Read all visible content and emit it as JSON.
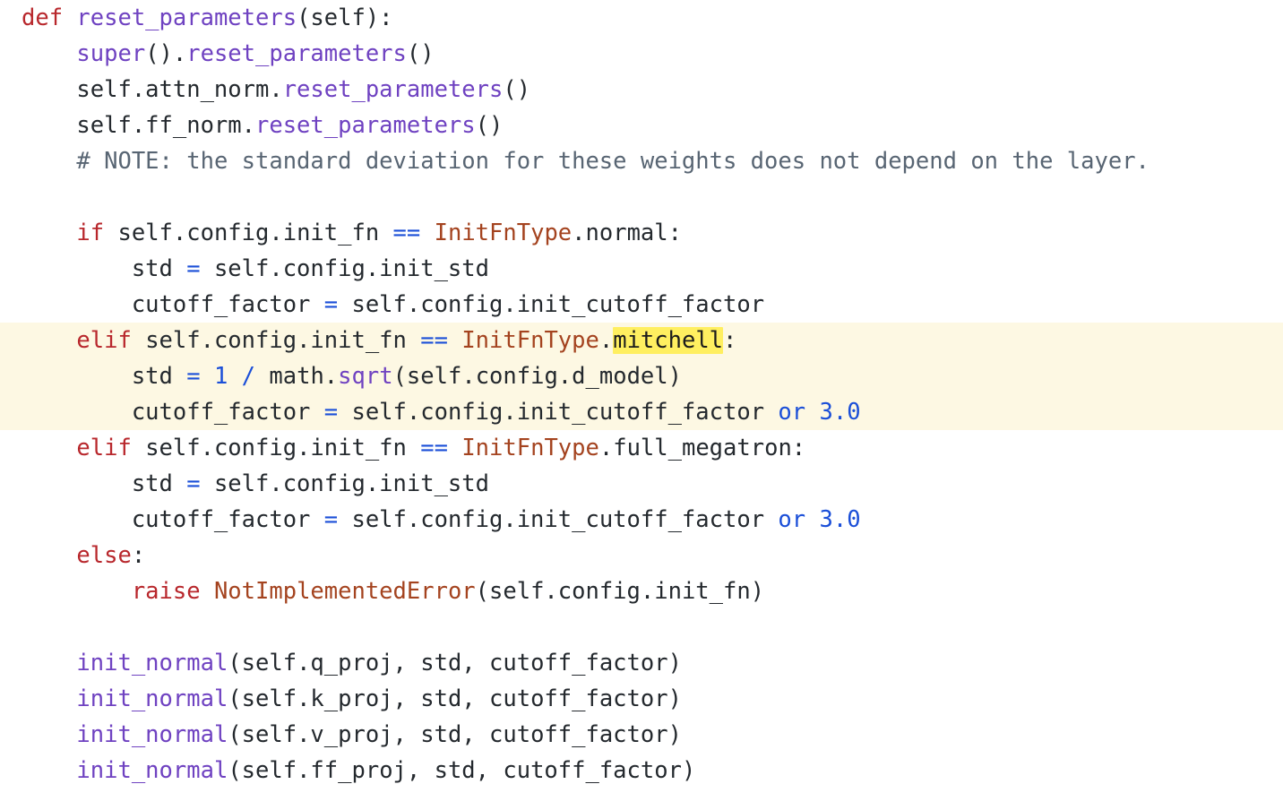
{
  "editor": {
    "background_color": "#ffffff",
    "text_color": "#24292e",
    "highlight_band_color": "#fdf8e3",
    "search_match_color": "#ffef60",
    "language": "python",
    "font_size_px": 25.5,
    "line_height_px": 40,
    "search_term": "mitchell"
  },
  "palette": {
    "keyword": "#b8272c",
    "function": "#6f42c1",
    "class_name": "#a4431f",
    "number": "#1b4fd8",
    "operator": "#1b4fd8",
    "comment": "#586573",
    "plain": "#24292e"
  },
  "code": {
    "plain_text": "def reset_parameters(self):\n    super().reset_parameters()\n    self.attn_norm.reset_parameters()\n    self.ff_norm.reset_parameters()\n    # NOTE: the standard deviation for these weights does not depend on the layer.\n\n    if self.config.init_fn == InitFnType.normal:\n        std = self.config.init_std\n        cutoff_factor = self.config.init_cutoff_factor\n    elif self.config.init_fn == InitFnType.mitchell:\n        std = 1 / math.sqrt(self.config.d_model)\n        cutoff_factor = self.config.init_cutoff_factor or 3.0\n    elif self.config.init_fn == InitFnType.full_megatron:\n        std = self.config.init_std\n        cutoff_factor = self.config.init_cutoff_factor or 3.0\n    else:\n        raise NotImplementedError(self.config.init_fn)\n\n    init_normal(self.q_proj, std, cutoff_factor)\n    init_normal(self.k_proj, std, cutoff_factor)\n    init_normal(self.v_proj, std, cutoff_factor)\n    init_normal(self.ff_proj, std, cutoff_factor)",
    "lines": [
      {
        "id": "line-1",
        "highlighted": false,
        "tokens": [
          {
            "t": "def ",
            "c": "kw"
          },
          {
            "t": "reset_parameters",
            "c": "fn"
          },
          {
            "t": "(self):",
            "c": "txt"
          }
        ]
      },
      {
        "id": "line-2",
        "highlighted": false,
        "tokens": [
          {
            "t": "    ",
            "c": "txt"
          },
          {
            "t": "super",
            "c": "fn"
          },
          {
            "t": "().",
            "c": "txt"
          },
          {
            "t": "reset_parameters",
            "c": "fn"
          },
          {
            "t": "()",
            "c": "txt"
          }
        ]
      },
      {
        "id": "line-3",
        "highlighted": false,
        "tokens": [
          {
            "t": "    self.attn_norm.",
            "c": "txt"
          },
          {
            "t": "reset_parameters",
            "c": "fn"
          },
          {
            "t": "()",
            "c": "txt"
          }
        ]
      },
      {
        "id": "line-4",
        "highlighted": false,
        "tokens": [
          {
            "t": "    self.ff_norm.",
            "c": "txt"
          },
          {
            "t": "reset_parameters",
            "c": "fn"
          },
          {
            "t": "()",
            "c": "txt"
          }
        ]
      },
      {
        "id": "line-5",
        "highlighted": false,
        "tokens": [
          {
            "t": "    ",
            "c": "txt"
          },
          {
            "t": "# NOTE: the standard deviation for these weights does not depend on the layer.",
            "c": "cmt"
          }
        ]
      },
      {
        "id": "line-6",
        "highlighted": false,
        "tokens": []
      },
      {
        "id": "line-7",
        "highlighted": false,
        "tokens": [
          {
            "t": "    ",
            "c": "txt"
          },
          {
            "t": "if",
            "c": "kw"
          },
          {
            "t": " self.config.init_fn ",
            "c": "txt"
          },
          {
            "t": "==",
            "c": "op"
          },
          {
            "t": " ",
            "c": "txt"
          },
          {
            "t": "InitFnType",
            "c": "cls"
          },
          {
            "t": ".normal:",
            "c": "txt"
          }
        ]
      },
      {
        "id": "line-8",
        "highlighted": false,
        "tokens": [
          {
            "t": "        std ",
            "c": "txt"
          },
          {
            "t": "=",
            "c": "op"
          },
          {
            "t": " self.config.init_std",
            "c": "txt"
          }
        ]
      },
      {
        "id": "line-9",
        "highlighted": false,
        "tokens": [
          {
            "t": "        cutoff_factor ",
            "c": "txt"
          },
          {
            "t": "=",
            "c": "op"
          },
          {
            "t": " self.config.init_cutoff_factor",
            "c": "txt"
          }
        ]
      },
      {
        "id": "line-10",
        "highlighted": true,
        "tokens": [
          {
            "t": "    ",
            "c": "txt"
          },
          {
            "t": "elif",
            "c": "kw"
          },
          {
            "t": " self.config.init_fn ",
            "c": "txt"
          },
          {
            "t": "==",
            "c": "op"
          },
          {
            "t": " ",
            "c": "txt"
          },
          {
            "t": "InitFnType",
            "c": "cls"
          },
          {
            "t": ".",
            "c": "txt"
          },
          {
            "t": "mitchell",
            "c": "mark"
          },
          {
            "t": ":",
            "c": "txt"
          }
        ]
      },
      {
        "id": "line-11",
        "highlighted": true,
        "tokens": [
          {
            "t": "        std ",
            "c": "txt"
          },
          {
            "t": "=",
            "c": "op"
          },
          {
            "t": " ",
            "c": "txt"
          },
          {
            "t": "1",
            "c": "num"
          },
          {
            "t": " ",
            "c": "txt"
          },
          {
            "t": "/",
            "c": "op"
          },
          {
            "t": " math.",
            "c": "txt"
          },
          {
            "t": "sqrt",
            "c": "fn"
          },
          {
            "t": "(self.config.d_model)",
            "c": "txt"
          }
        ]
      },
      {
        "id": "line-12",
        "highlighted": true,
        "tokens": [
          {
            "t": "        cutoff_factor ",
            "c": "txt"
          },
          {
            "t": "=",
            "c": "op"
          },
          {
            "t": " self.config.init_cutoff_factor ",
            "c": "txt"
          },
          {
            "t": "or",
            "c": "num"
          },
          {
            "t": " ",
            "c": "txt"
          },
          {
            "t": "3.0",
            "c": "num"
          }
        ]
      },
      {
        "id": "line-13",
        "highlighted": false,
        "tokens": [
          {
            "t": "    ",
            "c": "txt"
          },
          {
            "t": "elif",
            "c": "kw"
          },
          {
            "t": " self.config.init_fn ",
            "c": "txt"
          },
          {
            "t": "==",
            "c": "op"
          },
          {
            "t": " ",
            "c": "txt"
          },
          {
            "t": "InitFnType",
            "c": "cls"
          },
          {
            "t": ".full_megatron:",
            "c": "txt"
          }
        ]
      },
      {
        "id": "line-14",
        "highlighted": false,
        "tokens": [
          {
            "t": "        std ",
            "c": "txt"
          },
          {
            "t": "=",
            "c": "op"
          },
          {
            "t": " self.config.init_std",
            "c": "txt"
          }
        ]
      },
      {
        "id": "line-15",
        "highlighted": false,
        "tokens": [
          {
            "t": "        cutoff_factor ",
            "c": "txt"
          },
          {
            "t": "=",
            "c": "op"
          },
          {
            "t": " self.config.init_cutoff_factor ",
            "c": "txt"
          },
          {
            "t": "or",
            "c": "num"
          },
          {
            "t": " ",
            "c": "txt"
          },
          {
            "t": "3.0",
            "c": "num"
          }
        ]
      },
      {
        "id": "line-16",
        "highlighted": false,
        "tokens": [
          {
            "t": "    ",
            "c": "txt"
          },
          {
            "t": "else",
            "c": "kw"
          },
          {
            "t": ":",
            "c": "txt"
          }
        ]
      },
      {
        "id": "line-17",
        "highlighted": false,
        "tokens": [
          {
            "t": "        ",
            "c": "txt"
          },
          {
            "t": "raise",
            "c": "kw"
          },
          {
            "t": " ",
            "c": "txt"
          },
          {
            "t": "NotImplementedError",
            "c": "cls"
          },
          {
            "t": "(self.config.init_fn)",
            "c": "txt"
          }
        ]
      },
      {
        "id": "line-18",
        "highlighted": false,
        "tokens": []
      },
      {
        "id": "line-19",
        "highlighted": false,
        "tokens": [
          {
            "t": "    ",
            "c": "txt"
          },
          {
            "t": "init_normal",
            "c": "fn"
          },
          {
            "t": "(self.q_proj, std, cutoff_factor)",
            "c": "txt"
          }
        ]
      },
      {
        "id": "line-20",
        "highlighted": false,
        "tokens": [
          {
            "t": "    ",
            "c": "txt"
          },
          {
            "t": "init_normal",
            "c": "fn"
          },
          {
            "t": "(self.k_proj, std, cutoff_factor)",
            "c": "txt"
          }
        ]
      },
      {
        "id": "line-21",
        "highlighted": false,
        "tokens": [
          {
            "t": "    ",
            "c": "txt"
          },
          {
            "t": "init_normal",
            "c": "fn"
          },
          {
            "t": "(self.v_proj, std, cutoff_factor)",
            "c": "txt"
          }
        ]
      },
      {
        "id": "line-22",
        "highlighted": false,
        "tokens": [
          {
            "t": "    ",
            "c": "txt"
          },
          {
            "t": "init_normal",
            "c": "fn"
          },
          {
            "t": "(self.ff_proj, std, cutoff_factor)",
            "c": "txt"
          }
        ]
      }
    ]
  }
}
